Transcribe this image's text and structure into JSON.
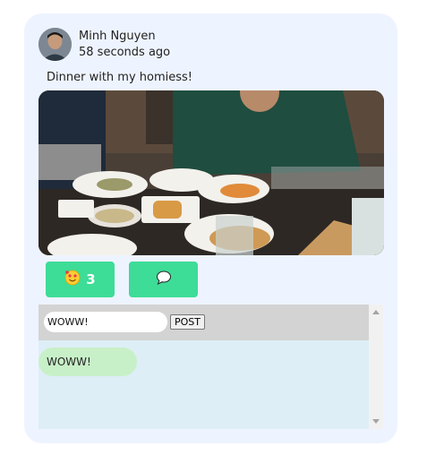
{
  "post": {
    "author": "Minh Nguyen",
    "time": "58 seconds ago",
    "text": "Dinner with my homiess!"
  },
  "reactions": {
    "like_icon": "smiling-face-with-hearts-icon",
    "like_count": "3",
    "comment_icon": "speech-bubble-icon"
  },
  "comment_box": {
    "input_value": "WOWW!",
    "post_label": "POST"
  },
  "comments": [
    {
      "text": "WOWW!"
    }
  ],
  "colors": {
    "card_bg": "#eef4ff",
    "button_bg": "#3ddc97",
    "comments_bg": "#ddeef6",
    "bubble_bg": "#c8f0c8"
  }
}
